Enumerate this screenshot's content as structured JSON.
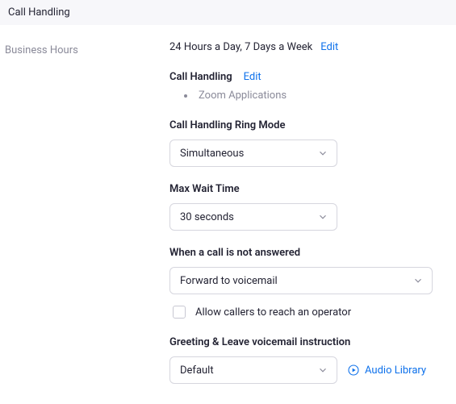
{
  "header": {
    "title": "Call Handling"
  },
  "sidebar": {
    "label": "Business Hours"
  },
  "hours": {
    "value": "24 Hours a Day, 7 Days a Week",
    "edit": "Edit"
  },
  "call_handling": {
    "title": "Call Handling",
    "edit": "Edit",
    "items": [
      "Zoom Applications"
    ]
  },
  "ring_mode": {
    "label": "Call Handling Ring Mode",
    "selected": "Simultaneous"
  },
  "max_wait": {
    "label": "Max Wait Time",
    "selected": "30 seconds"
  },
  "not_answered": {
    "label": "When a call is not answered",
    "selected": "Forward to voicemail",
    "checkbox_label": "Allow callers to reach an operator"
  },
  "greeting": {
    "label": "Greeting & Leave voicemail instruction",
    "selected": "Default",
    "audio_library": "Audio Library"
  }
}
